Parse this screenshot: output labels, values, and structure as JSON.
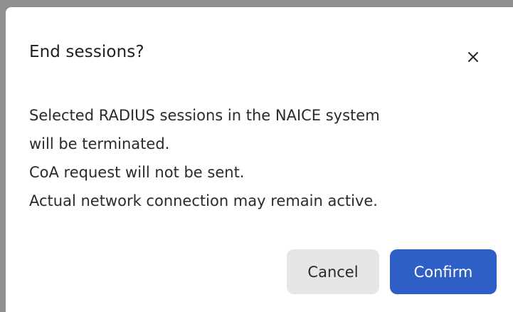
{
  "dialog": {
    "title": "End sessions?",
    "close_icon": "close-icon",
    "message_lines": [
      "Selected RADIUS sessions in the NAICE system",
      "will be terminated.",
      "CoA request will not be sent.",
      "Actual network connection may remain active."
    ],
    "buttons": {
      "cancel_label": "Cancel",
      "confirm_label": "Confirm"
    }
  },
  "colors": {
    "backdrop": "#8f8f8f",
    "dialog_bg": "#ffffff",
    "confirm_bg": "#2e5fc7",
    "cancel_bg": "#e6e6e6"
  }
}
